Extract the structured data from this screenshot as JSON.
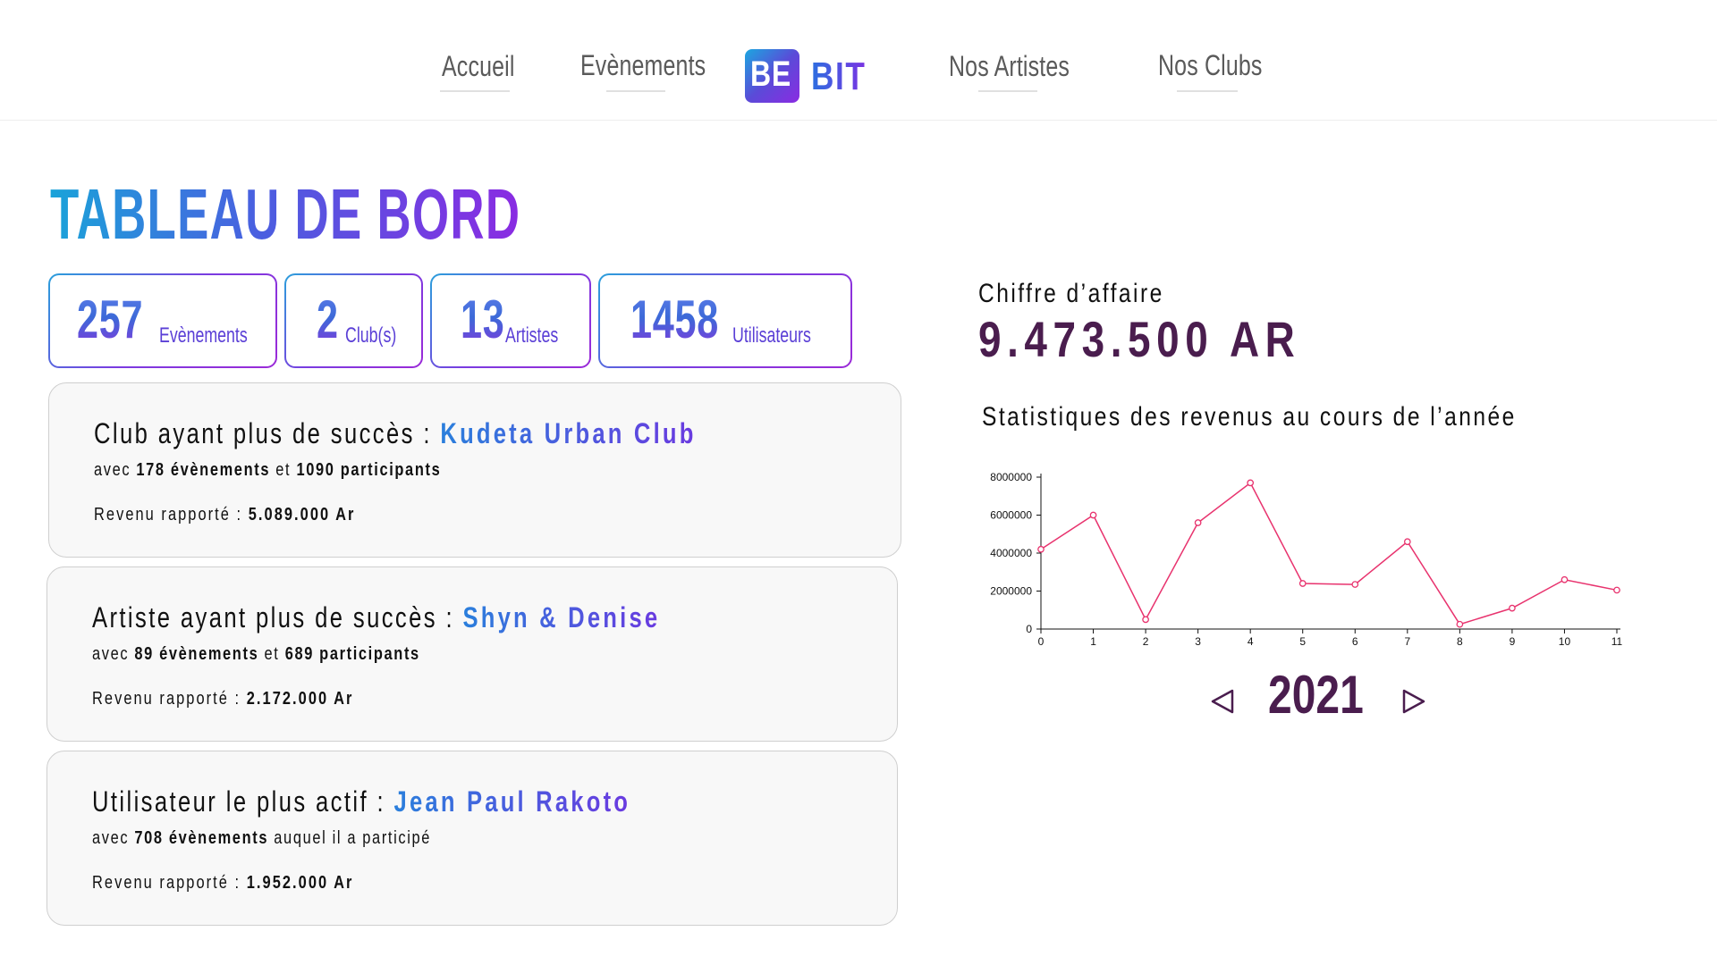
{
  "nav": {
    "links": [
      "Accueil",
      "Evènements",
      "Nos Artistes",
      "Nos Clubs"
    ],
    "logo": {
      "box_text": "BE",
      "text": "BIT"
    }
  },
  "dashboard": {
    "title": "TABLEAU DE BORD",
    "stats": [
      {
        "value": "257",
        "label": "Evènements"
      },
      {
        "value": "2",
        "label": "Club(s)"
      },
      {
        "value": "13",
        "label": "Artistes"
      },
      {
        "value": "1458",
        "label": "Utilisateurs"
      }
    ],
    "cards": [
      {
        "heading": "Club ayant plus de succès :",
        "name": "Kudeta Urban Club",
        "detail_prefix": "avec",
        "events": "178 évènements",
        "detail_mid": "et",
        "participants": "1090 participants",
        "revenue_label": "Revenu rapporté :",
        "revenue": "5.089.000 Ar"
      },
      {
        "heading": "Artiste ayant plus de succès :",
        "name": "Shyn & Denise",
        "detail_prefix": "avec",
        "events": "89 évènements",
        "detail_mid": "et",
        "participants": "689 participants",
        "revenue_label": "Revenu rapporté :",
        "revenue": "2.172.000 Ar"
      },
      {
        "heading": "Utilisateur le plus actif :",
        "name": "Jean Paul Rakoto",
        "detail_prefix": "avec",
        "events": "708 évènements",
        "detail_mid": "auquel il a participé",
        "participants": "",
        "revenue_label": "Revenu rapporté :",
        "revenue": "1.952.000 Ar"
      }
    ]
  },
  "revenue": {
    "label": "Chiffre d’affaire",
    "value": "9.473.500 AR",
    "chart_title": "Statistiques des revenus au cours de l’année",
    "year": "2021",
    "prev_icon": "chevron-left-icon",
    "next_icon": "chevron-right-icon"
  },
  "chart_data": {
    "type": "line",
    "title": "Statistiques des revenus au cours de l’année",
    "x": [
      0,
      1,
      2,
      3,
      4,
      5,
      6,
      7,
      8,
      9,
      10,
      11
    ],
    "series": [
      {
        "values": [
          4200000,
          6000000,
          500000,
          5600000,
          7700000,
          2400000,
          2350000,
          4600000,
          250000,
          1100000,
          2600000,
          2050000
        ]
      }
    ],
    "yticks": [
      0,
      2000000,
      4000000,
      6000000,
      8000000
    ],
    "ylim": [
      0,
      8000000
    ],
    "xlim": [
      0,
      11
    ],
    "grid": false,
    "line_color": "#e8336e"
  },
  "colors": {
    "accent_blue": "#2a7fdc",
    "accent_purple": "#7a32e2",
    "dark_plum": "#4a1d4e"
  }
}
